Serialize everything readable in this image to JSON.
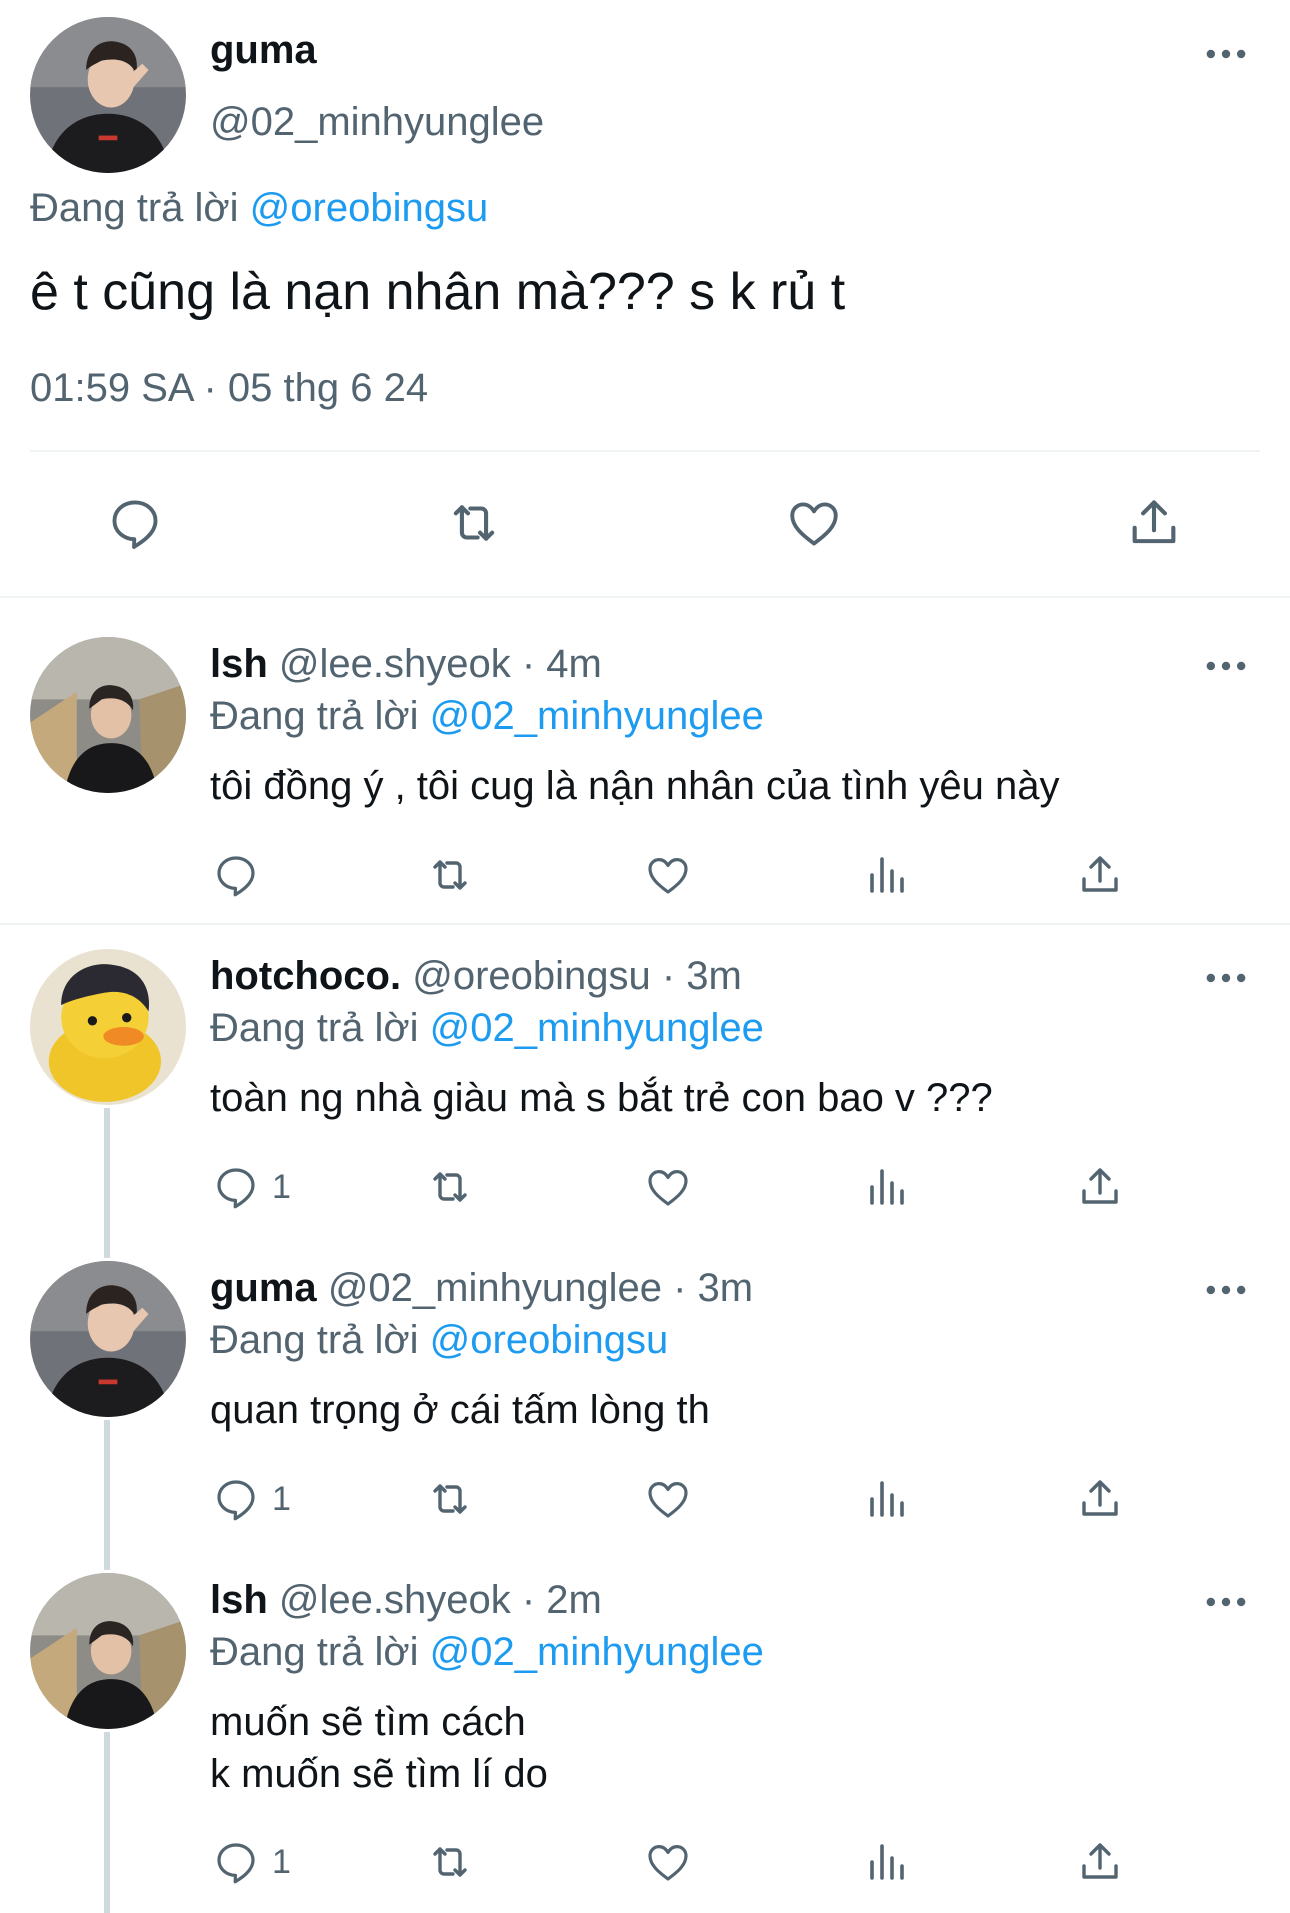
{
  "main_tweet": {
    "author_name": "guma",
    "author_handle": "@02_minhyunglee",
    "replying_prefix": "Đang trả lời ",
    "replying_to": "@oreobingsu",
    "text": "ê t cũng là nạn nhân mà??? s k rủ t",
    "timestamp": "01:59 SA · 05 thg 6 24"
  },
  "replies": [
    {
      "name": "lsh",
      "handle": "@lee.shyeok · 4m",
      "replying_prefix": "Đang trả lời ",
      "replying_to": "@02_minhyunglee",
      "text": "tôi đồng ý , tôi cug là nận nhân của tình yêu này",
      "reply_count": ""
    },
    {
      "name": "hotchoco.",
      "handle": "@oreobingsu · 3m",
      "replying_prefix": "Đang trả lời ",
      "replying_to": "@02_minhyunglee",
      "text": "toàn ng nhà giàu mà s bắt trẻ con bao v ???",
      "reply_count": "1"
    },
    {
      "name": "guma",
      "handle": "@02_minhyunglee · 3m",
      "replying_prefix": "Đang trả lời ",
      "replying_to": "@oreobingsu",
      "text": "quan trọng ở cái tấm lòng th",
      "reply_count": "1"
    },
    {
      "name": "lsh",
      "handle": "@lee.shyeok · 2m",
      "replying_prefix": "Đang trả lời ",
      "replying_to": "@02_minhyunglee",
      "text": "muốn sẽ tìm cách\nk muốn sẽ tìm lí do",
      "reply_count": "1"
    }
  ],
  "icons": {
    "reply": "reply-icon",
    "retweet": "retweet-icon",
    "like": "heart-icon",
    "views": "views-icon",
    "share": "share-icon",
    "more": "more-icon"
  },
  "colors": {
    "accent": "#1d9bf0",
    "secondary_text": "#536471",
    "divider": "#eff3f4",
    "thread_line": "#cfd9de"
  }
}
